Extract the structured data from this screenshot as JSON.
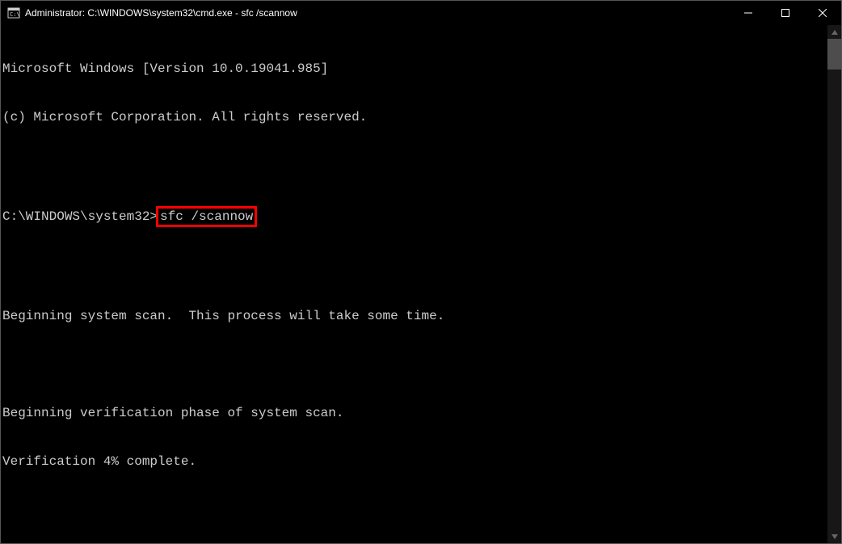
{
  "titlebar": {
    "title": "Administrator: C:\\WINDOWS\\system32\\cmd.exe - sfc  /scannow"
  },
  "terminal": {
    "line1": "Microsoft Windows [Version 10.0.19041.985]",
    "line2": "(c) Microsoft Corporation. All rights reserved.",
    "blank1": "",
    "prompt": "C:\\WINDOWS\\system32>",
    "command": "sfc /scannow",
    "blank2": "",
    "line4": "Beginning system scan.  This process will take some time.",
    "blank3": "",
    "line5": "Beginning verification phase of system scan.",
    "line6": "Verification 4% complete."
  }
}
